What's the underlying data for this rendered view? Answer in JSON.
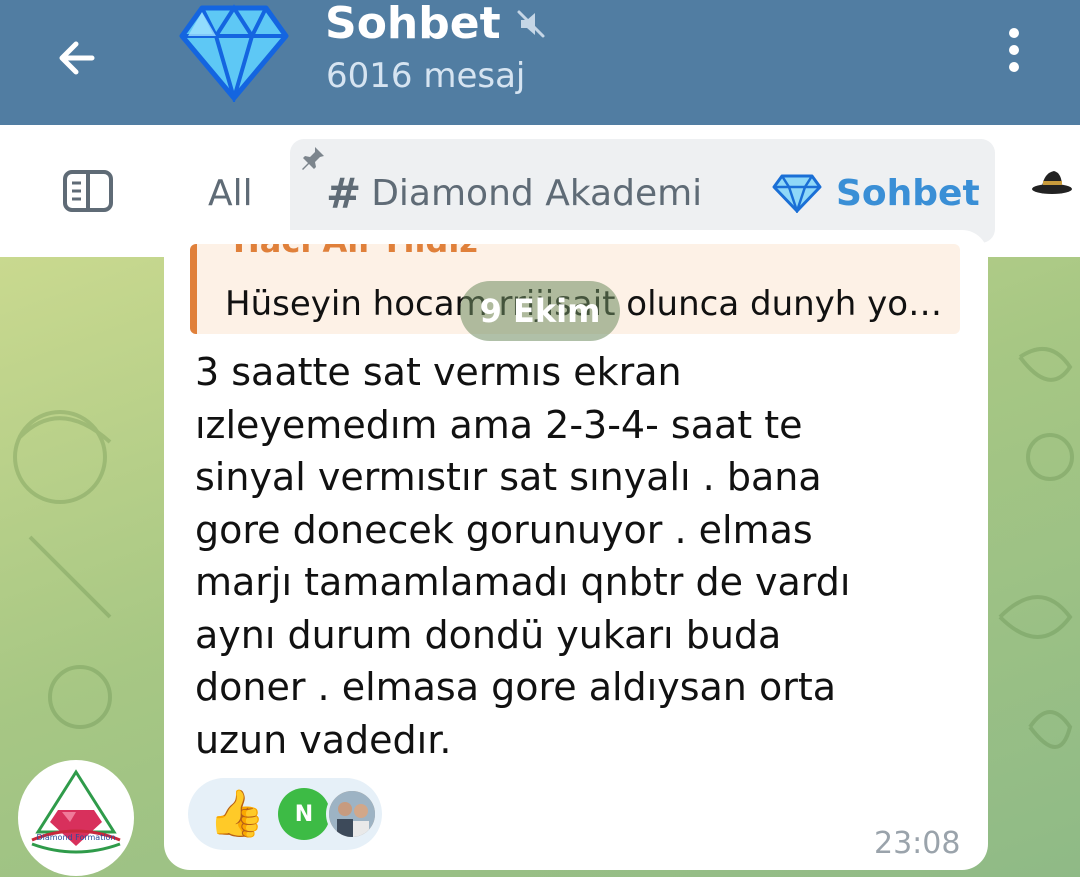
{
  "header": {
    "back_icon": "arrow-left-icon",
    "title": "Sohbet",
    "muted_icon": "speaker-muted-icon",
    "subtitle": "6016 mesaj",
    "more_icon": "vertical-dots-icon",
    "background_color": "#517da2"
  },
  "tabs": {
    "sidebar_icon": "sidebar-toggle-icon",
    "items": [
      {
        "label": "All",
        "selected": false
      },
      {
        "label": "Diamond Akademi",
        "selected": false,
        "pinned": true,
        "icon": "hash-icon"
      },
      {
        "label": "Sohbet",
        "selected": true,
        "icon": "diamond-icon"
      }
    ],
    "active_color": "#3a8fd6"
  },
  "message": {
    "reply_author": "Hacı Ali Yıldız",
    "reply_text": "Hüseyin hocam rrijisait olunca dunyh yo…",
    "date_badge": "9 Ekim",
    "text": "3 saatte sat vermıs ekran\nızleyemedım ama 2-3-4- saat te\nsinyal vermıstır sat sınyalı  . bana\ngore donecek gorunuyor . elmas\nmarjı tamamlamadı qnbtr de vardı\naynı durum dondü yukarı buda\ndoner . elmasa gore aldıysan orta\nuzun vadedır.",
    "reaction_emoji": "👍",
    "reactor_initial": "N",
    "time": "23:08",
    "sender_avatar_text": "Diamond Formation"
  }
}
